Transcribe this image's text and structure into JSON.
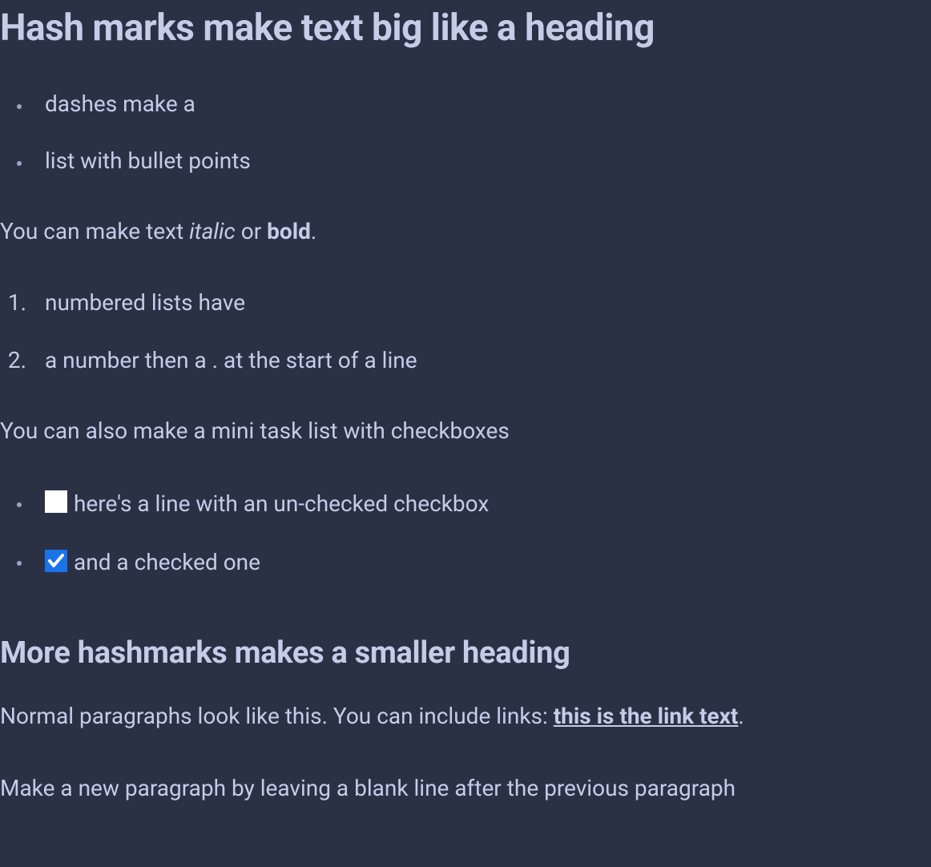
{
  "heading1": "Hash marks make text big like a heading",
  "bullet_list": [
    "dashes make a",
    "list with bullet points"
  ],
  "paragraph_styling": {
    "prefix": "You can make text ",
    "italic": "italic",
    "middle": " or ",
    "bold": "bold",
    "suffix": "."
  },
  "numbered_list": [
    "numbered lists have",
    "a number then a . at the start of a line"
  ],
  "paragraph_tasks": "You can also make a mini task list with checkboxes",
  "task_list": [
    {
      "checked": false,
      "text": "here's a line with an un-checked checkbox"
    },
    {
      "checked": true,
      "text": "and a checked one"
    }
  ],
  "heading2": "More hashmarks makes a smaller heading",
  "paragraph_links": {
    "prefix": "Normal paragraphs look like this. You can include links: ",
    "link_text": "this is the link text",
    "suffix": "."
  },
  "paragraph_new": "Make a new paragraph by leaving a blank line after the previous paragraph"
}
